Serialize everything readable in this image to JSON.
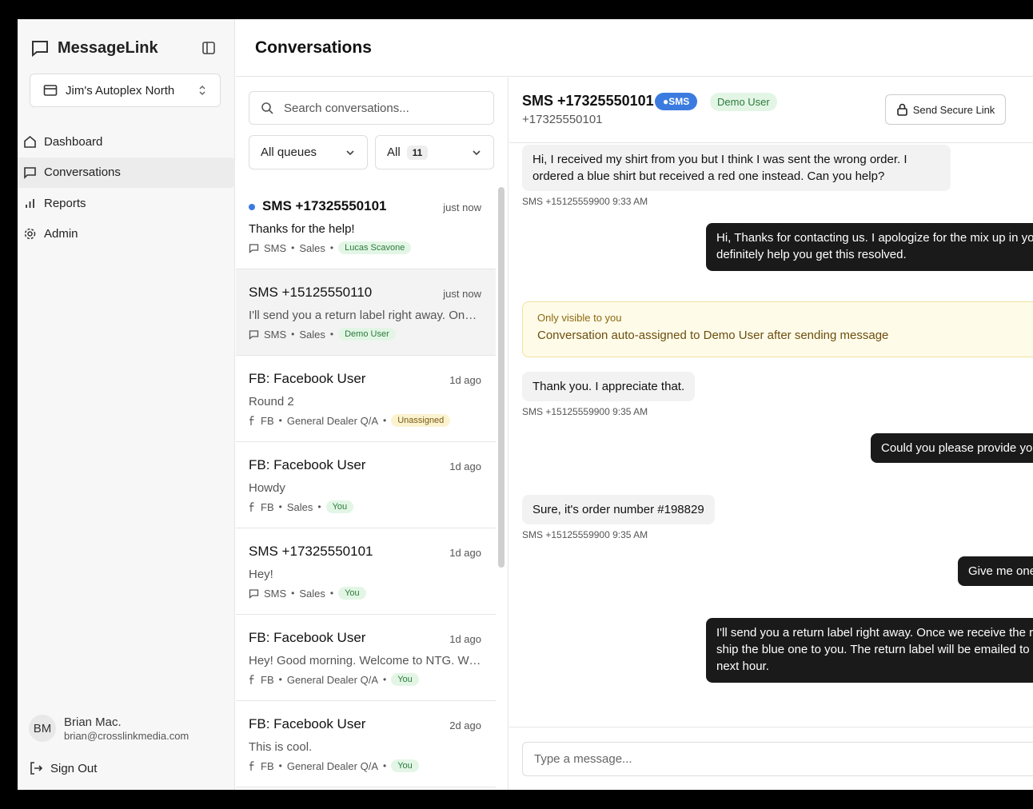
{
  "app": {
    "name": "MessageLink"
  },
  "store": {
    "name": "Jim's Autoplex North"
  },
  "nav": [
    {
      "label": "Dashboard",
      "icon": "home-icon"
    },
    {
      "label": "Conversations",
      "icon": "chat-icon"
    },
    {
      "label": "Reports",
      "icon": "bar-chart-icon"
    },
    {
      "label": "Admin",
      "icon": "gear-icon"
    }
  ],
  "user": {
    "initials": "BM",
    "name": "Brian Mac.",
    "email": "brian@crosslinkmedia.com",
    "signout": "Sign Out"
  },
  "page": {
    "title": "Conversations"
  },
  "search": {
    "placeholder": "Search conversations..."
  },
  "filters": {
    "queue": "All queues",
    "status": "All",
    "count": "11"
  },
  "conversations": [
    {
      "title": "SMS +17325550101",
      "time": "just now",
      "preview": "Thanks for the help!",
      "channel": "SMS",
      "queue": "Sales",
      "assignee": "Lucas Scavone",
      "unread": true
    },
    {
      "title": "SMS +15125550110",
      "time": "just now",
      "preview": "I'll send you a return label right away. Once we receive the red shirt we'll ship the blue one to you.",
      "channel": "SMS",
      "queue": "Sales",
      "assignee": "Demo User",
      "unread": false
    },
    {
      "title": "FB: Facebook User",
      "time": "1d ago",
      "preview": "Round 2",
      "channel": "FB",
      "queue": "General Dealer Q/A",
      "assignee": "Unassigned",
      "unread": false
    },
    {
      "title": "FB: Facebook User",
      "time": "1d ago",
      "preview": "Howdy",
      "channel": "FB",
      "queue": "Sales",
      "assignee": "You",
      "unread": false
    },
    {
      "title": "SMS +17325550101",
      "time": "1d ago",
      "preview": "Hey!",
      "channel": "SMS",
      "queue": "Sales",
      "assignee": "You",
      "unread": false
    },
    {
      "title": "FB: Facebook User",
      "time": "1d ago",
      "preview": "Hey! Good morning. Welcome to NTG. We're here to help you with anything.",
      "channel": "FB",
      "queue": "General Dealer Q/A",
      "assignee": "You",
      "unread": false
    },
    {
      "title": "FB: Facebook User",
      "time": "2d ago",
      "preview": "This is cool.",
      "channel": "FB",
      "queue": "General Dealer Q/A",
      "assignee": "You",
      "unread": false
    }
  ],
  "chat": {
    "title": "SMS +17325550101",
    "subtitle": "+17325550101",
    "channel_badge": "SMS",
    "agent_badge": "Demo User",
    "secure_link": "Send Secure Link",
    "messages": [
      {
        "line1": "Hi, I received my shirt from you but I think I was sent the wrong order. I",
        "line2": "ordered a blue shirt but received a red one instead. Can you help?",
        "meta": "SMS +15125559900 9:33 AM"
      },
      {
        "line1": "Hi, Thanks for contacting us. I apologize for the mix up in yo",
        "line2": "definitely help you get this resolved."
      },
      {
        "line1": "Thank you. I appreciate that.",
        "meta": "SMS +15125559900 9:35 AM"
      },
      {
        "line1": "Could you please provide yo"
      },
      {
        "line1": "Sure, it's order number #198829",
        "meta": "SMS +15125559900 9:35 AM"
      },
      {
        "line1": "Give me one"
      },
      {
        "line1": "I'll send you a return label right away. Once we receive the r",
        "line2": "ship the blue one to you. The return label will be emailed to",
        "line3": "next hour."
      }
    ],
    "note": {
      "label": "Only visible to you",
      "text": "Conversation auto-assigned to Demo User after sending message"
    },
    "composer_placeholder": "Type a message..."
  }
}
